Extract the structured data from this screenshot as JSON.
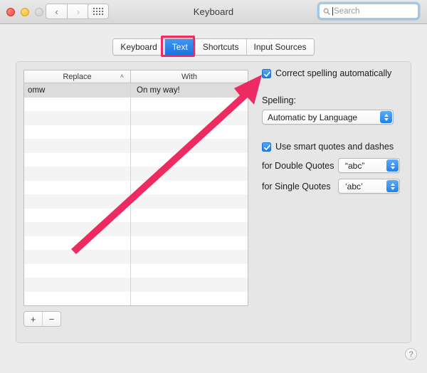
{
  "window": {
    "title": "Keyboard",
    "traffic_lights": [
      "close-button",
      "minimize-button",
      "zoom-button-disabled"
    ],
    "nav": {
      "back_label": "‹",
      "forward_label": "›",
      "grid_icon": "show-all-icon"
    },
    "search": {
      "placeholder": "Search",
      "value": "",
      "icon": "search-icon"
    }
  },
  "tabs": [
    {
      "label": "Keyboard",
      "active": false
    },
    {
      "label": "Text",
      "active": true
    },
    {
      "label": "Shortcuts",
      "active": false
    },
    {
      "label": "Input Sources",
      "active": false
    }
  ],
  "table": {
    "columns": [
      {
        "label": "Replace",
        "sort": "ascending",
        "sort_glyph": "˄"
      },
      {
        "label": "With",
        "sort": "none",
        "sort_glyph": ""
      }
    ],
    "rows": [
      {
        "replace": "omw",
        "with": "On my way!",
        "selected": true
      }
    ],
    "empty_row_count": 15
  },
  "list_controls": {
    "add_label": "+",
    "remove_label": "−"
  },
  "options": {
    "correct_spelling": {
      "label": "Correct spelling automatically",
      "checked": true
    },
    "spelling": {
      "label": "Spelling:",
      "value": "Automatic by Language"
    },
    "smart_quotes": {
      "label": "Use smart quotes and dashes",
      "checked": true
    },
    "double_quotes": {
      "label": "for Double Quotes",
      "value": "“abc”"
    },
    "single_quotes": {
      "label": "for Single Quotes",
      "value": "‘abc’"
    }
  },
  "help": {
    "label": "?"
  },
  "annotation": {
    "arrow_color": "#ed2a62",
    "highlight_color": "#ed2a62",
    "highlight_target": "Text",
    "arrow_points_to": "Correct spelling automatically"
  }
}
